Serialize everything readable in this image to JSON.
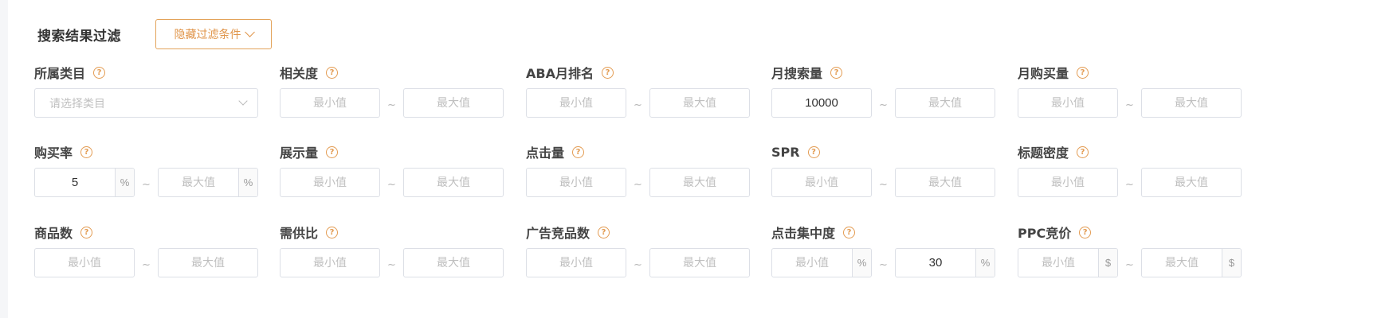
{
  "header": {
    "title": "搜索结果过滤",
    "toggle_label": "隐藏过滤条件"
  },
  "placeholders": {
    "min": "最小值",
    "max": "最大值",
    "category": "请选择类目"
  },
  "separator": "~",
  "help_glyph": "?",
  "colors": {
    "accent": "#e39c53",
    "border": "#dcdfe6",
    "placeholder": "#bfbfbf"
  },
  "filters": {
    "category": {
      "label": "所属类目"
    },
    "relevance": {
      "label": "相关度",
      "min": "",
      "max": ""
    },
    "aba_rank": {
      "label": "ABA月排名",
      "min": "",
      "max": ""
    },
    "monthly_search": {
      "label": "月搜索量",
      "min": "10000",
      "max": ""
    },
    "monthly_purchase": {
      "label": "月购买量",
      "min": "",
      "max": ""
    },
    "purchase_rate": {
      "label": "购买率",
      "min": "5",
      "max": "",
      "unit": "%"
    },
    "impressions": {
      "label": "展示量",
      "min": "",
      "max": ""
    },
    "clicks": {
      "label": "点击量",
      "min": "",
      "max": ""
    },
    "spr": {
      "label": "SPR",
      "min": "",
      "max": ""
    },
    "title_density": {
      "label": "标题密度",
      "min": "",
      "max": ""
    },
    "product_count": {
      "label": "商品数",
      "min": "",
      "max": ""
    },
    "supply_demand": {
      "label": "需供比",
      "min": "",
      "max": ""
    },
    "ad_product_count": {
      "label": "广告竞品数",
      "min": "",
      "max": ""
    },
    "click_concentration": {
      "label": "点击集中度",
      "min": "",
      "max": "30",
      "unit": "%"
    },
    "ppc_bid": {
      "label": "PPC竞价",
      "min": "",
      "max": "",
      "unit": "$"
    }
  }
}
